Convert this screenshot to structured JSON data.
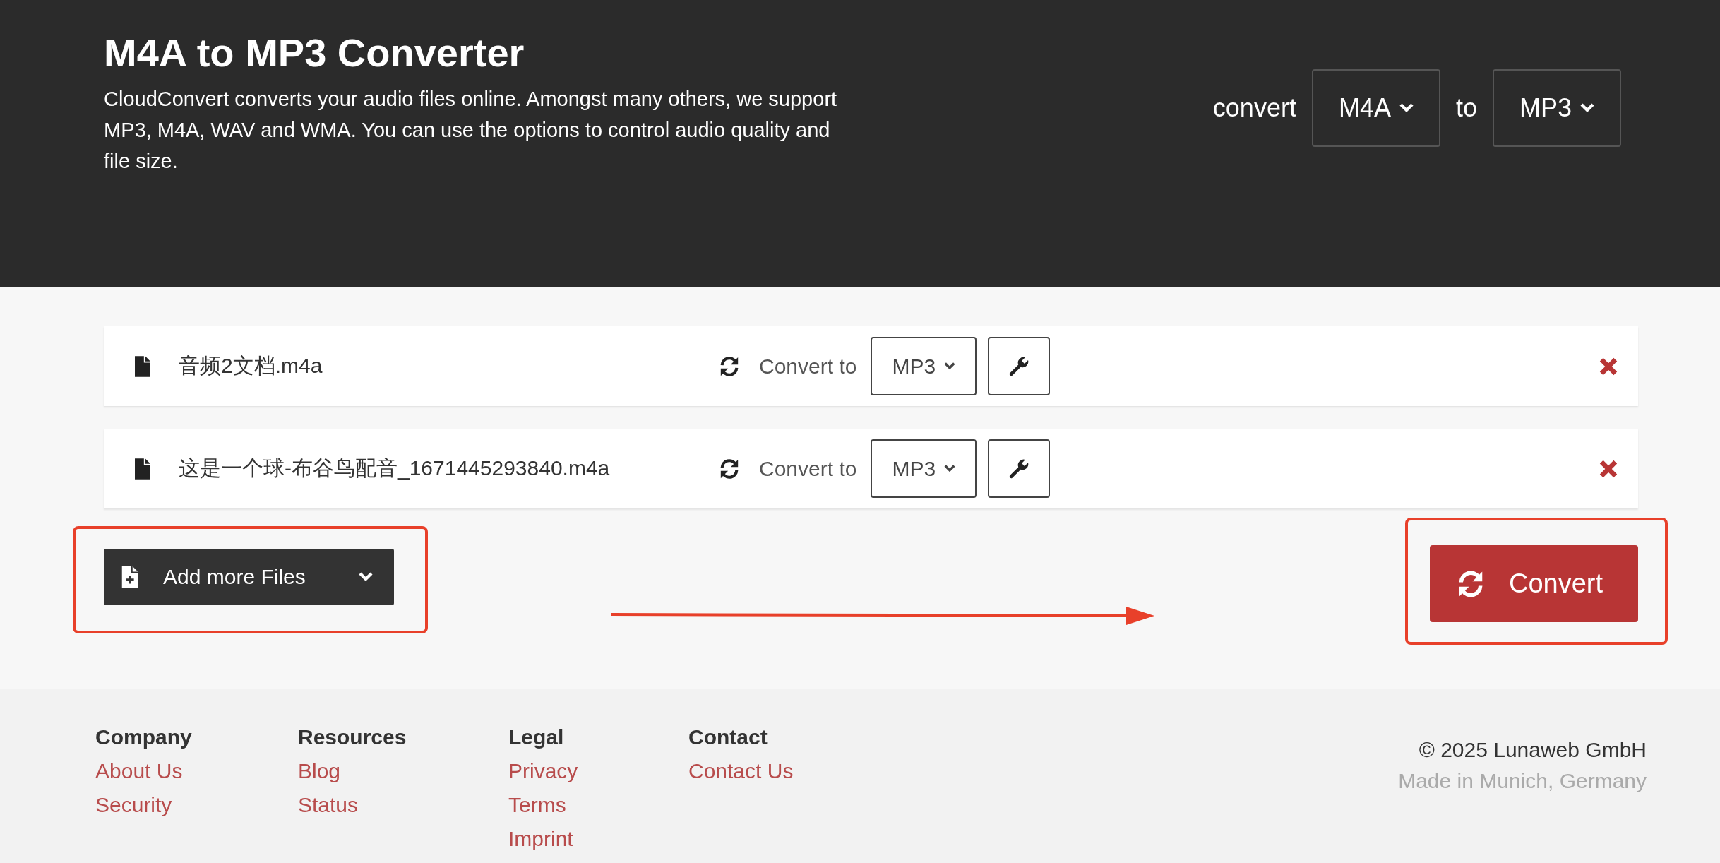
{
  "header": {
    "title": "M4A to MP3 Converter",
    "description": "CloudConvert converts your audio files online. Amongst many others, we support MP3, M4A, WAV and WMA. You can use the options to control audio quality and file size.",
    "convert_label": "convert",
    "from_format": "M4A",
    "to_label": "to",
    "to_format": "MP3"
  },
  "files": [
    {
      "name": "音频2文档.m4a",
      "convert_label": "Convert to",
      "format": "MP3"
    },
    {
      "name": "这是一个球-布谷鸟配音_1671445293840.m4a",
      "convert_label": "Convert to",
      "format": "MP3"
    }
  ],
  "add_files_button": "Add more Files",
  "convert_button": "Convert",
  "footer": {
    "columns": [
      {
        "heading": "Company",
        "links": [
          "About Us",
          "Security"
        ]
      },
      {
        "heading": "Resources",
        "links": [
          "Blog",
          "Status"
        ]
      },
      {
        "heading": "Legal",
        "links": [
          "Privacy",
          "Terms",
          "Imprint"
        ]
      },
      {
        "heading": "Contact",
        "links": [
          "Contact Us"
        ]
      }
    ],
    "copyright": "© 2025 Lunaweb GmbH",
    "location": "Made in Munich, Germany"
  }
}
